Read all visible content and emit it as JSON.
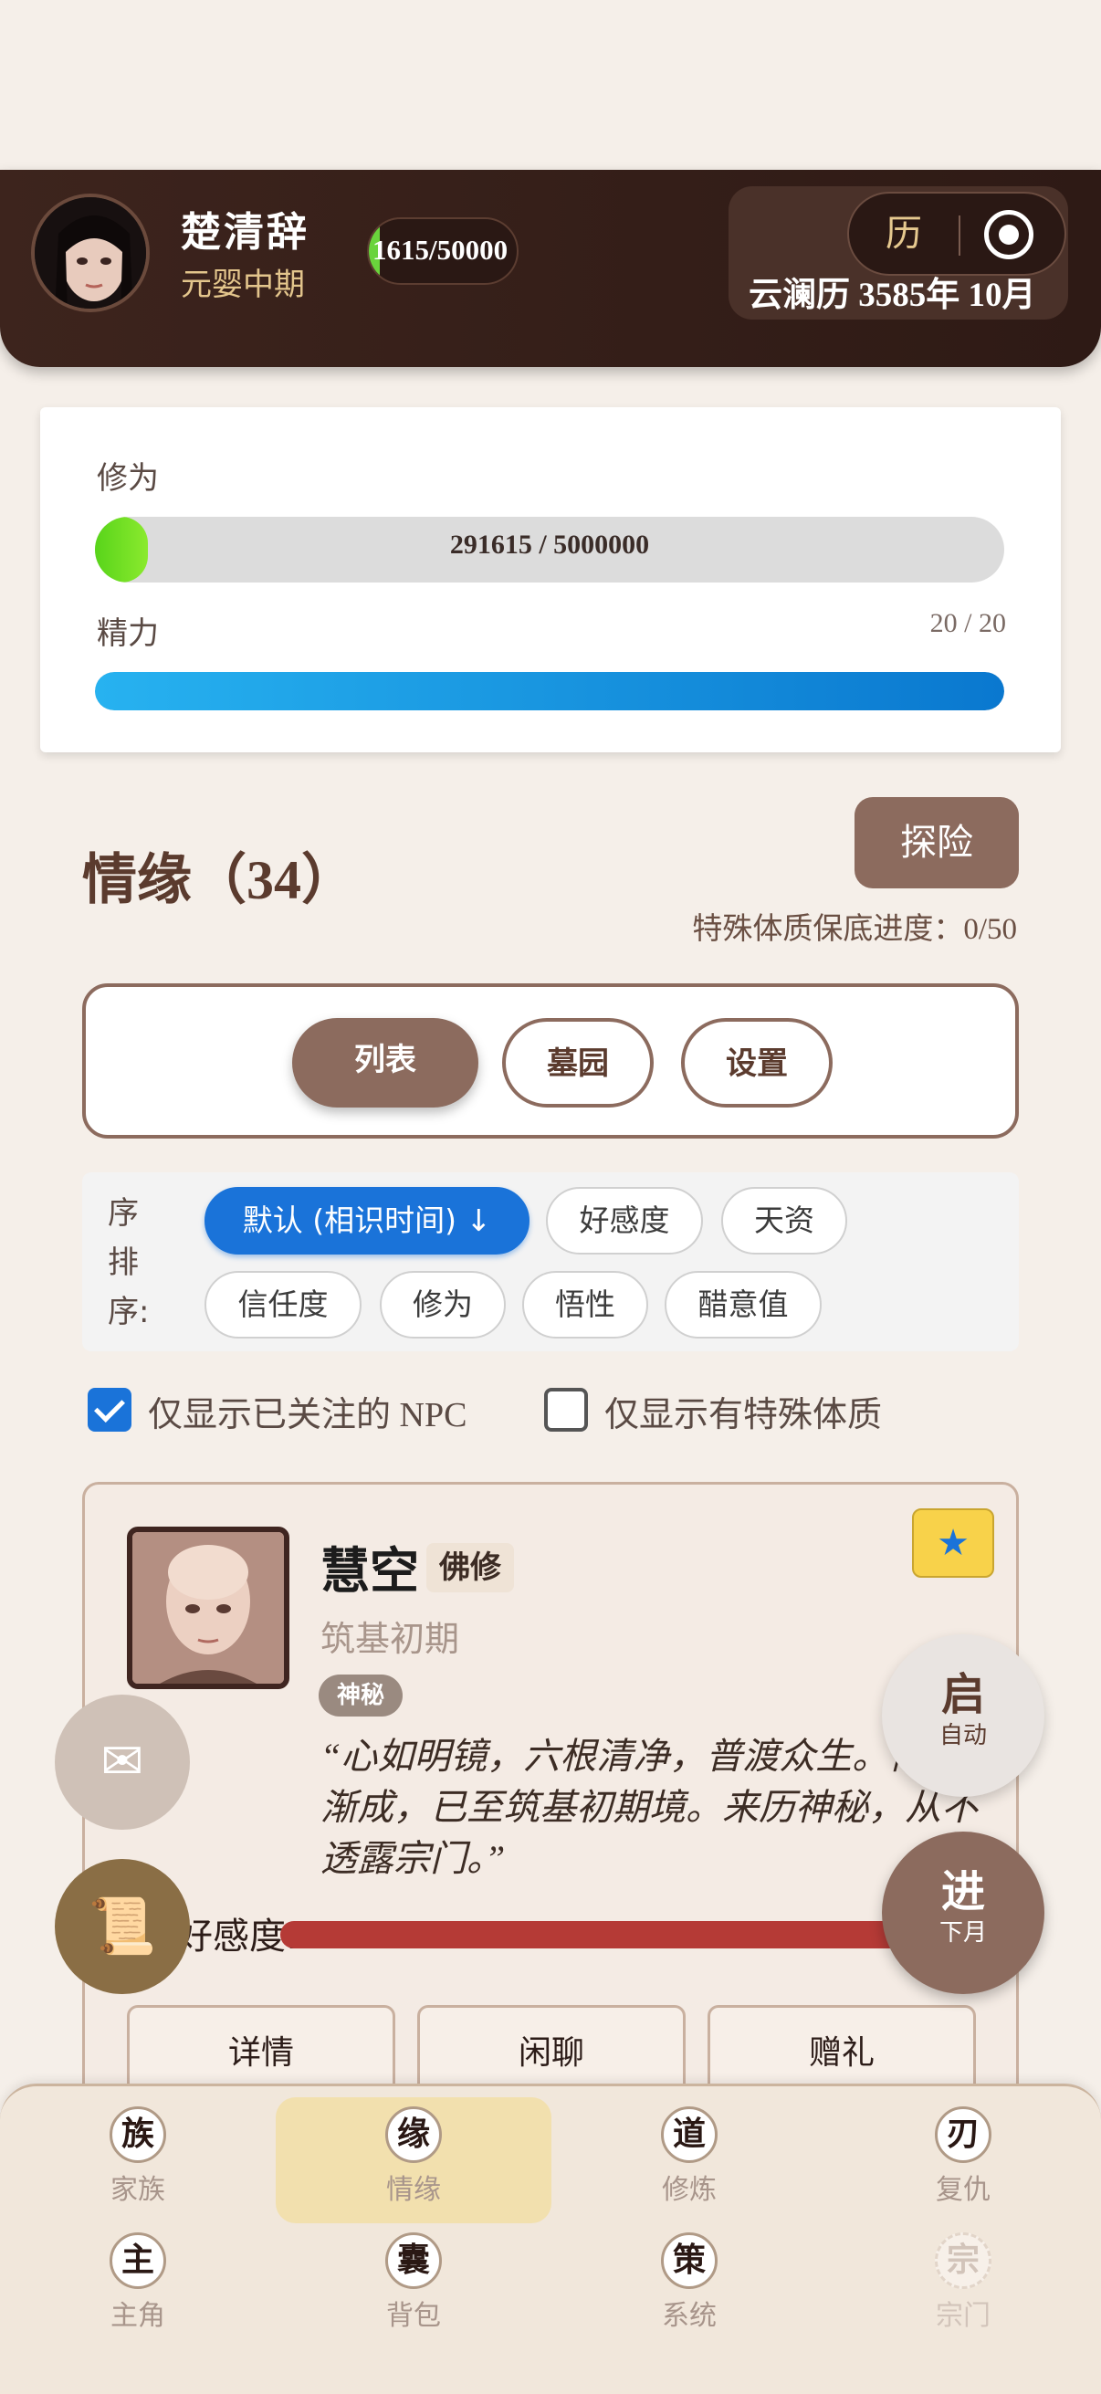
{
  "header": {
    "name": "楚清辞",
    "realm": "元婴中期",
    "mini_exp": "1615/50000",
    "date": "云澜历 3585年 10月",
    "calendar_glyph": "历",
    "calendar_icon": "calendar-icon",
    "record_icon": "record-icon"
  },
  "stats": {
    "cultivation_label": "修为",
    "cultivation_value": "291615 / 5000000",
    "cultivation_fraction": 0.058,
    "energy_label": "精力",
    "energy_value": "20 / 20",
    "energy_fraction": 1.0
  },
  "section": {
    "title": "情缘（34）",
    "explore_label": "探险",
    "guarantee": "特殊体质保底进度：0/50"
  },
  "tabs": [
    {
      "label": "列表",
      "active": true
    },
    {
      "label": "墓园",
      "active": false
    },
    {
      "label": "设置",
      "active": false
    }
  ],
  "sort": {
    "label": "序排序:",
    "options": [
      "默认 (相识时间) ↓",
      "好感度",
      "天资",
      "信任度",
      "修为",
      "悟性",
      "醋意值"
    ],
    "active_index": 0
  },
  "filters": {
    "followed_label": "仅显示已关注的 NPC",
    "followed_checked": true,
    "special_label": "仅显示有特殊体质",
    "special_checked": false
  },
  "npc": {
    "name": "慧空",
    "tag": "佛修",
    "realm": "筑基初期",
    "badge": "神秘",
    "quote": "“心如明镜，六根清净，普渡众生。修行渐成，已至筑基初期境。来历神秘，从不透露宗门。”",
    "affinity_label": "好感度:",
    "affinity_fraction": 0.82,
    "favorite_icon": "star-icon",
    "actions": [
      "详情",
      "闲聊",
      "赠礼"
    ],
    "colors": {
      "affinity": "#b53a36",
      "favorite": "#f8d24a"
    }
  },
  "floats": {
    "mail_icon": "mail-icon",
    "scroll_icon": "scroll-icon",
    "auto_big": "启",
    "auto_small": "自动",
    "next_big": "进",
    "next_small": "下月"
  },
  "nav": {
    "row1": [
      {
        "glyph": "族",
        "label": "家族"
      },
      {
        "glyph": "缘",
        "label": "情缘"
      },
      {
        "glyph": "道",
        "label": "修炼"
      },
      {
        "glyph": "刃",
        "label": "复仇"
      }
    ],
    "row2": [
      {
        "glyph": "主",
        "label": "主角"
      },
      {
        "glyph": "囊",
        "label": "背包"
      },
      {
        "glyph": "策",
        "label": "系统"
      },
      {
        "glyph": "宗",
        "label": "宗门"
      }
    ]
  },
  "colors": {
    "primary": "#8c6b5e",
    "header": "#3d241d",
    "accent_blue": "#1a73d9",
    "exp_green": "#6ad43c"
  }
}
